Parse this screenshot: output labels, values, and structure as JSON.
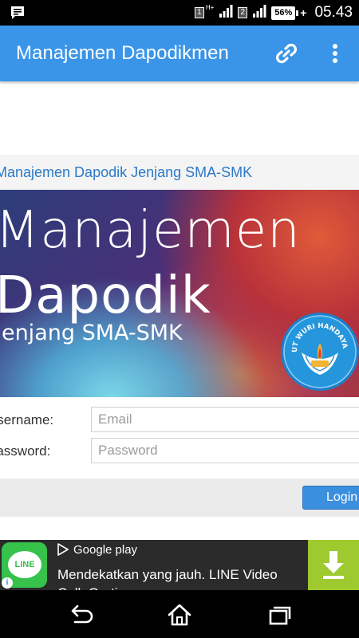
{
  "status_bar": {
    "sim1": "1",
    "network_type": "H+",
    "sim2": "2",
    "battery_percent": "56%",
    "time": "05.43",
    "icons": [
      "chat-bubble-icon",
      "signal-icon",
      "battery-icon",
      "charging-icon"
    ]
  },
  "app_bar": {
    "title": "Manajemen Dapodikmen",
    "actions": [
      "link-icon",
      "more-vert-icon"
    ]
  },
  "page": {
    "header": "Manajemen Dapodik Jenjang SMA-SMK",
    "banner": {
      "line1": "Manajemen",
      "line2": "Dapodik",
      "line3": "Jenjang SMA-SMK",
      "logo_text": "TUT WURI HANDAYANI"
    },
    "form": {
      "username_label": "Username:",
      "username_placeholder": "Email",
      "password_label": "Password:",
      "password_placeholder": "Password",
      "login_label": "Login"
    }
  },
  "ad": {
    "app_logo_text": "LINE",
    "store": "Google play",
    "text": "Mendekatkan yang jauh. LINE Video Call. Gratis",
    "info_icon": "i",
    "cta_icon": "download-icon"
  },
  "nav_bar": {
    "buttons": [
      "back-icon",
      "home-icon",
      "recents-icon"
    ]
  },
  "colors": {
    "app_bar": "#3a95e8",
    "header_text": "#2a79c8",
    "login_button": "#3a8fde",
    "ad_cta": "#9ec92f",
    "line_green": "#36c24b"
  }
}
